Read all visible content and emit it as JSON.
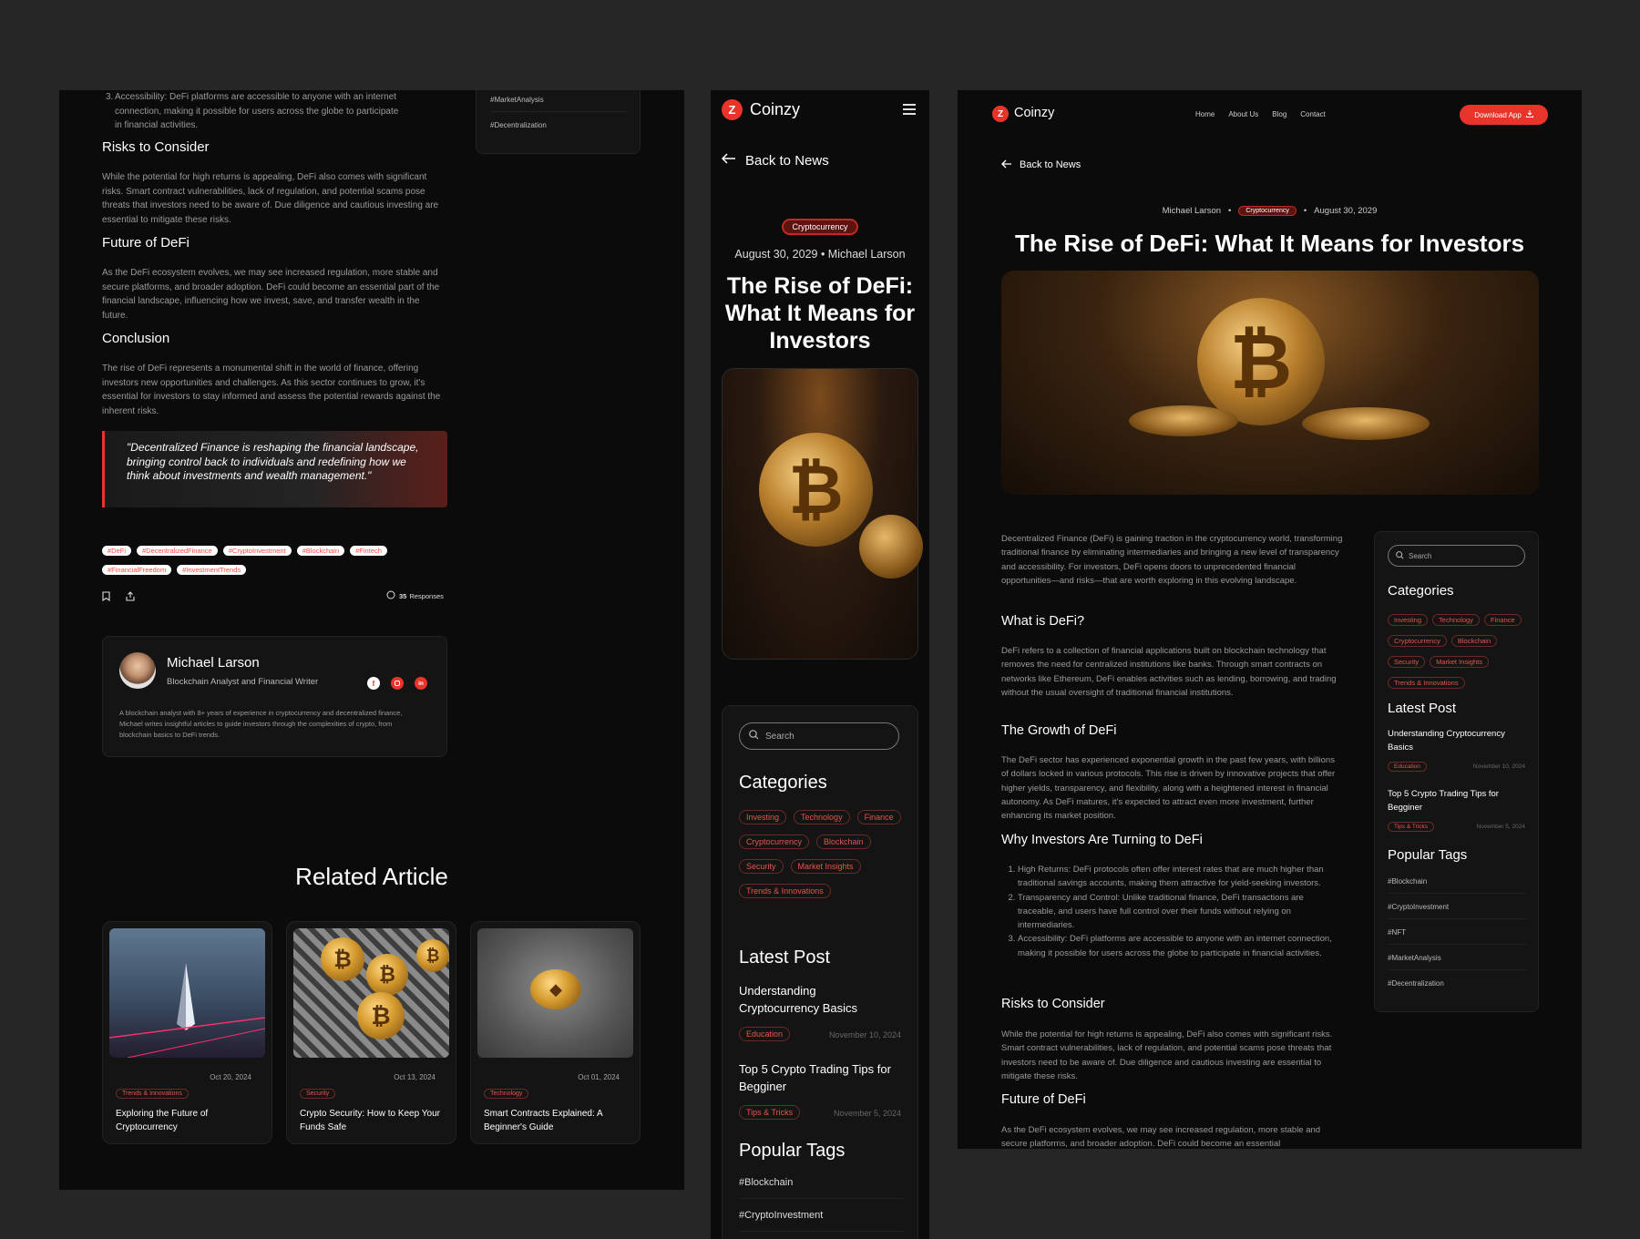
{
  "left": {
    "top_tags": [
      "#MarketAnalysis",
      "#Decentralization"
    ],
    "list_item_3": "Accessibility: DeFi platforms are accessible to anyone with an internet connection, making it possible for users across the globe to participate in financial activities.",
    "risks_heading": "Risks to Consider",
    "risks_text": "While the potential for high returns is appealing, DeFi also comes with significant risks. Smart contract vulnerabilities, lack of regulation, and potential scams pose threats that investors need to be aware of. Due diligence and cautious investing are essential to mitigate these risks.",
    "future_heading": "Future of DeFi",
    "future_text": "As the DeFi ecosystem evolves, we may see increased regulation, more stable and secure platforms, and broader adoption. DeFi could become an essential part of the financial landscape, influencing how we invest, save, and transfer wealth in the future.",
    "conclusion_heading": "Conclusion",
    "conclusion_text": "The rise of DeFi represents a monumental shift in the world of finance, offering investors new opportunities and challenges. As this sector continues to grow, it's essential for investors to stay informed and assess the potential rewards against the inherent risks.",
    "quote": "\"Decentralized Finance is reshaping the financial landscape, bringing control back to individuals and redefining how we think about investments and wealth management.\"",
    "tags": [
      "#DeFi",
      "#DecentralizedFinance",
      "#CryptoInvestment",
      "#Blockchain",
      "#Fintech",
      "#FinancialFreedom",
      "#InvestmentTrends"
    ],
    "responses_count": "35",
    "responses_label": "Responses",
    "author": {
      "name": "Michael Larson",
      "role": "Blockchain Analyst and Financial Writer",
      "bio": "A blockchain analyst with 8+ years of experience in cryptocurrency and decentralized finance, Michael writes insightful articles to guide investors through the complexities of crypto, from blockchain basics to DeFi trends."
    },
    "related_heading": "Related Article",
    "related": [
      {
        "date": "Oct 20, 2024",
        "tag": "Trends & Innovations",
        "title": "Exploring the Future of Cryptocurrency"
      },
      {
        "date": "Oct 13, 2024",
        "tag": "Security",
        "title": "Crypto Security: How to Keep Your Funds Safe"
      },
      {
        "date": "Oct 01, 2024",
        "tag": "Technology",
        "title": "Smart Contracts Explained: A Beginner's Guide"
      }
    ]
  },
  "mid": {
    "brand": "Coinzy",
    "logo_letter": "Z",
    "back_label": "Back to News",
    "category": "Cryptocurrency",
    "date": "August 30, 2029",
    "author": "Michael Larson",
    "title": "The Rise of DeFi: What It Means for Investors",
    "search_placeholder": "Search",
    "categories_heading": "Categories",
    "categories": [
      "Investing",
      "Technology",
      "Finance",
      "Cryptocurrency",
      "Blockchain",
      "Security",
      "Market Insights",
      "Trends & Innovations"
    ],
    "latest_heading": "Latest Post",
    "latest": [
      {
        "title": "Understanding Cryptocurrency Basics",
        "tag": "Education",
        "date": "November 10, 2024"
      },
      {
        "title": "Top 5 Crypto Trading Tips for Begginer",
        "tag": "Tips & Tricks",
        "date": "November 5, 2024"
      }
    ],
    "popular_heading": "Popular Tags",
    "popular_tags": [
      "#Blockchain",
      "#CryptoInvestment"
    ]
  },
  "right": {
    "brand": "Coinzy",
    "logo_letter": "Z",
    "nav": [
      "Home",
      "About Us",
      "Blog",
      "Contact"
    ],
    "download_label": "Download App",
    "back_label": "Back to News",
    "author": "Michael Larson",
    "category": "Cryptocurrency",
    "date": "August 30, 2029",
    "title": "The Rise of DeFi: What It Means for Investors",
    "intro": "Decentralized Finance (DeFi) is gaining traction in the cryptocurrency world, transforming traditional finance by eliminating intermediaries and bringing a new level of transparency and accessibility. For investors, DeFi opens doors to unprecedented financial opportunities—and risks—that are worth exploring in this evolving landscape.",
    "what_heading": "What is DeFi?",
    "what_text": "DeFi refers to a collection of financial applications built on blockchain technology that removes the need for centralized institutions like banks. Through smart contracts on networks like Ethereum, DeFi enables activities such as lending, borrowing, and trading without the usual oversight of traditional financial institutions.",
    "growth_heading": "The Growth of DeFi",
    "growth_text": "The DeFi sector has experienced exponential growth in the past few years, with billions of dollars locked in various protocols. This rise is driven by innovative projects that offer higher yields, transparency, and flexibility, along with a heightened interest in financial autonomy. As DeFi matures, it's expected to attract even more investment, further enhancing its market position.",
    "why_heading": "Why Investors Are Turning to DeFi",
    "why_list": [
      "High Returns: DeFi protocols often offer interest rates that are much higher than traditional savings accounts, making them attractive for yield-seeking investors.",
      "Transparency and Control: Unlike traditional finance, DeFi transactions are traceable, and users have full control over their funds without relying on intermediaries.",
      "Accessibility: DeFi platforms are accessible to anyone with an internet connection, making it possible for users across the globe to participate in financial activities."
    ],
    "risks_heading": "Risks to Consider",
    "risks_text": "While the potential for high returns is appealing, DeFi also comes with significant risks. Smart contract vulnerabilities, lack of regulation, and potential scams pose threats that investors need to be aware of. Due diligence and cautious investing are essential to mitigate these risks.",
    "future_heading": "Future of DeFi",
    "future_text": "As the DeFi ecosystem evolves, we may see increased regulation, more stable and secure platforms, and broader adoption. DeFi could become an essential",
    "search_placeholder": "Search",
    "categories_heading": "Categories",
    "categories": [
      "Investing",
      "Technology",
      "Finance",
      "Cryptocurrency",
      "Blockchain",
      "Security",
      "Market Insights",
      "Trends & Innovations"
    ],
    "latest_heading": "Latest Post",
    "latest": [
      {
        "title": "Understanding Cryptocurrency Basics",
        "tag": "Education",
        "date": "November 10, 2024"
      },
      {
        "title": "Top 5 Crypto Trading Tips for Begginer",
        "tag": "Tips & Tricks",
        "date": "November 5, 2024"
      }
    ],
    "popular_heading": "Popular Tags",
    "popular_tags": [
      "#Blockchain",
      "#CryptoInvestment",
      "#NFT",
      "#MarketAnalysis",
      "#Decentralization"
    ]
  },
  "colors": {
    "accent": "#e8342a",
    "background": "#262626",
    "panel": "#0b0b0b"
  }
}
